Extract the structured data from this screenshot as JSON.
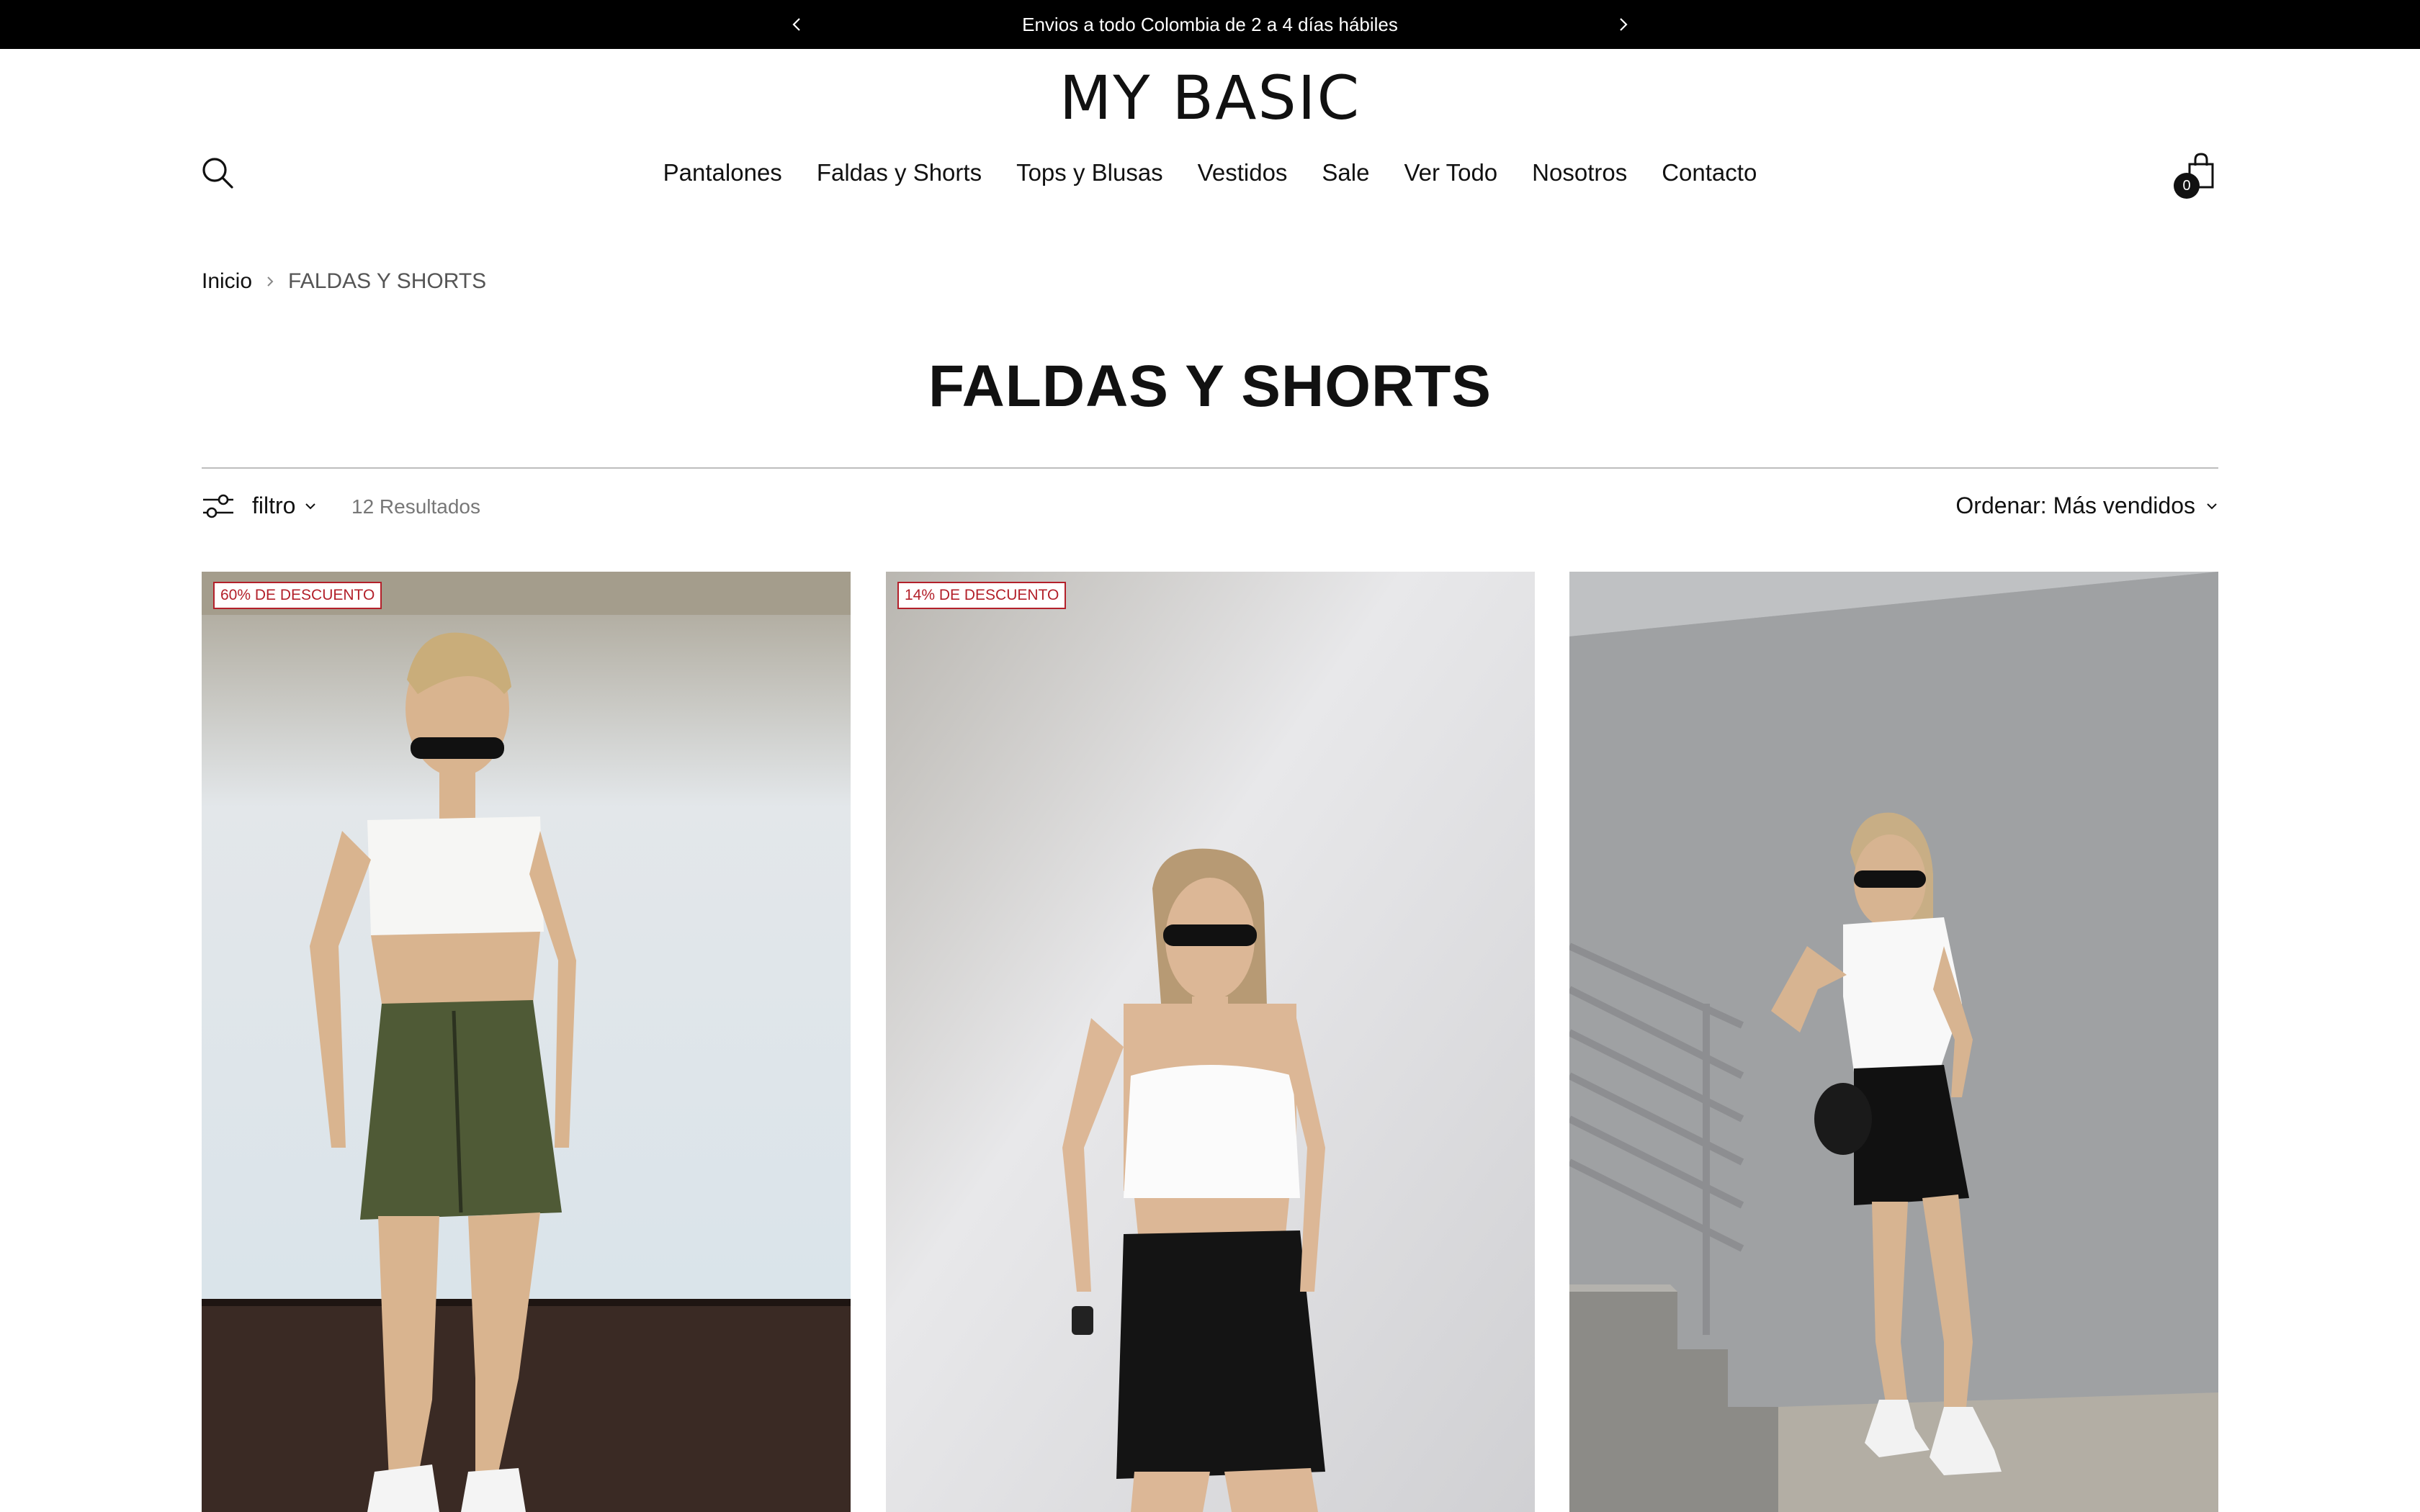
{
  "announcement": {
    "text": "Envios a todo Colombia de 2 a 4 días hábiles"
  },
  "header": {
    "logo": "MY BASIC",
    "cart_count": "0",
    "nav": [
      {
        "label": "Pantalones"
      },
      {
        "label": "Faldas y Shorts"
      },
      {
        "label": "Tops y Blusas"
      },
      {
        "label": "Vestidos"
      },
      {
        "label": "Sale"
      },
      {
        "label": "Ver Todo"
      },
      {
        "label": "Nosotros"
      },
      {
        "label": "Contacto"
      }
    ]
  },
  "breadcrumb": {
    "home": "Inicio",
    "current": "FALDAS Y SHORTS"
  },
  "page": {
    "title": "FALDAS Y SHORTS"
  },
  "toolbar": {
    "filter_label": "filtro",
    "results": "12 Resultados",
    "sort_label": "Ordenar: Más vendidos"
  },
  "products": [
    {
      "badge": "60% DE DESCUENTO",
      "image": "model in white bandeau top and olive cargo skirt"
    },
    {
      "badge": "14% DE DESCUENTO",
      "image": "model in white ruffle crop top and black leather shorts"
    },
    {
      "badge": "",
      "image": "model in white tee and black pleated skort on stairs"
    }
  ],
  "icons": {
    "prev": "chevron-left-icon",
    "next": "chevron-right-icon",
    "search": "search-icon",
    "cart": "shopping-bag-icon",
    "filter": "sliders-icon",
    "dropdown": "chevron-down-icon"
  },
  "colors": {
    "announcement_bg": "#000000",
    "badge": "#b3202a",
    "text": "#111111"
  }
}
